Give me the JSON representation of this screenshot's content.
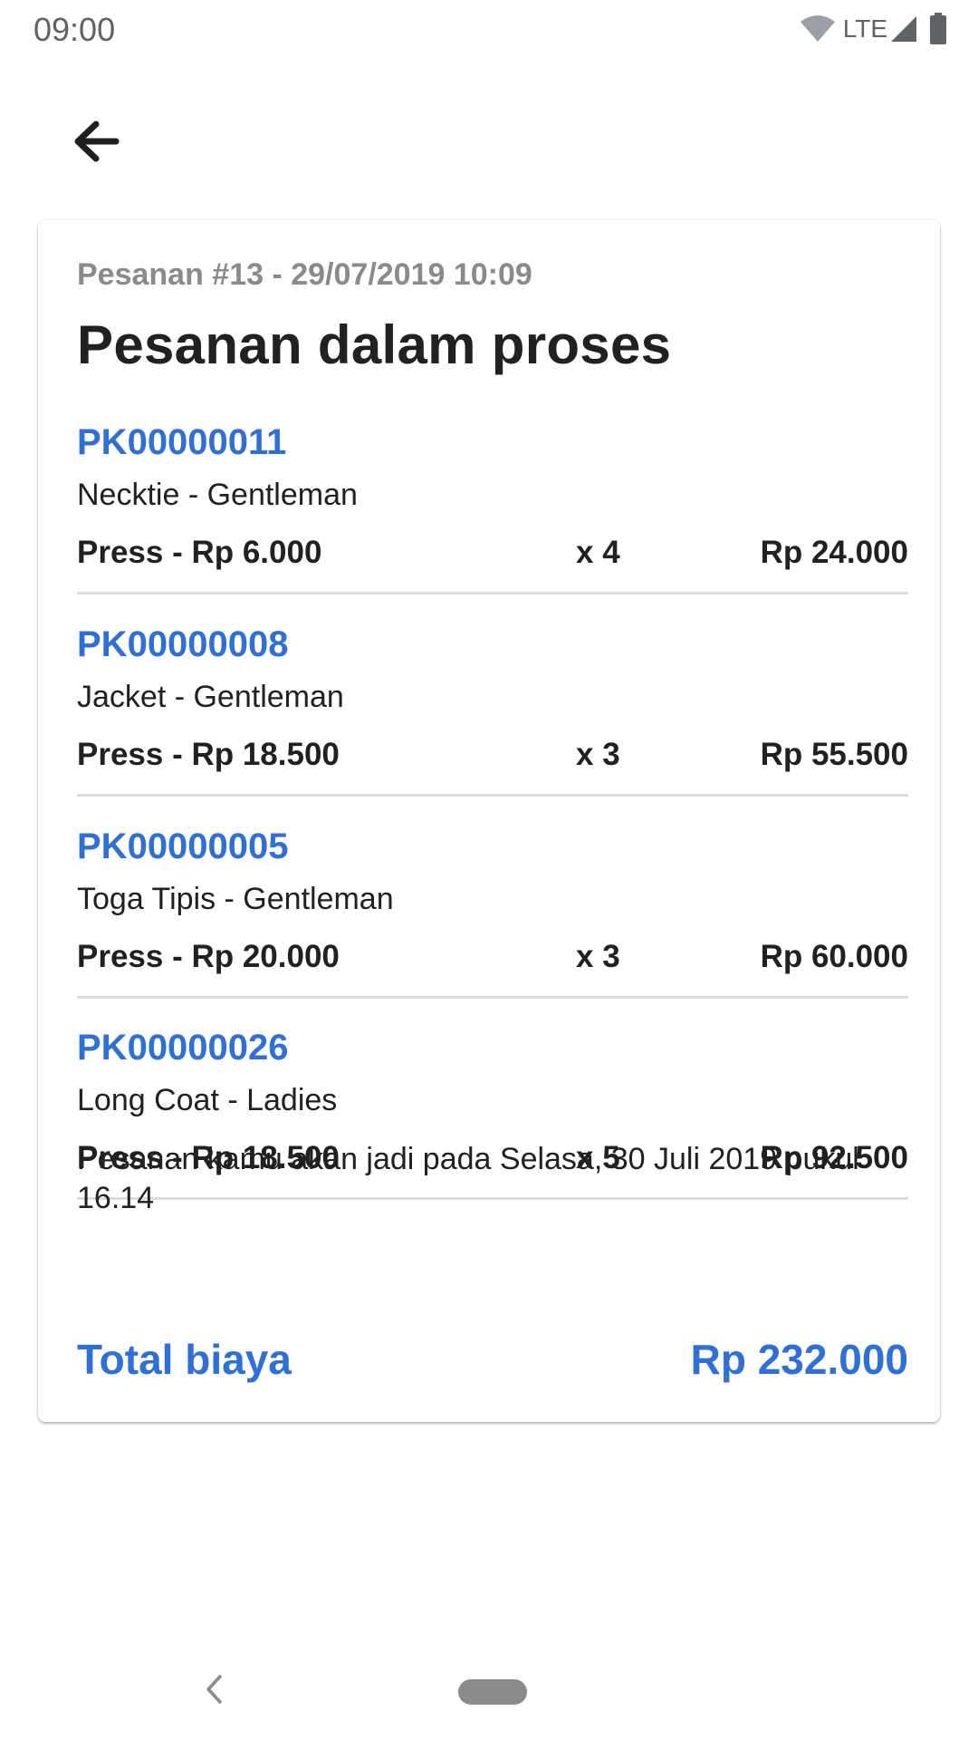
{
  "status_bar": {
    "time": "09:00",
    "network": "LTE",
    "icons": [
      "wifi-icon",
      "signal-icon",
      "battery-icon"
    ]
  },
  "app_bar": {
    "back_icon": "arrow-left-icon"
  },
  "order": {
    "meta": "Pesanan #13 - 29/07/2019 10:09",
    "status_title": "Pesanan dalam proses",
    "items": [
      {
        "code": "PK00000011",
        "name": "Necktie - Gentleman",
        "service": "Press - Rp 6.000",
        "quantity": "x 4",
        "subtotal": "Rp 24.000"
      },
      {
        "code": "PK00000008",
        "name": "Jacket - Gentleman",
        "service": "Press - Rp 18.500",
        "quantity": "x 3",
        "subtotal": "Rp 55.500"
      },
      {
        "code": "PK00000005",
        "name": "Toga Tipis - Gentleman",
        "service": "Press - Rp 20.000",
        "quantity": "x 3",
        "subtotal": "Rp 60.000"
      },
      {
        "code": "PK00000026",
        "name": "Long Coat - Ladies",
        "service": "Press - Rp 18.500",
        "quantity": "x 5",
        "subtotal": "Rp 92.500"
      }
    ],
    "completion_note": "Pesanan kamu akan jadi pada Selasa, 30 Juli 2019 pukul 16.14",
    "total_label": "Total biaya",
    "total_value": "Rp 232.000"
  },
  "colors": {
    "accent": "#2f6fd6",
    "text": "#212121",
    "muted": "#8a8a8a",
    "divider": "#dcdcdc"
  },
  "nav_bar": {
    "icons": [
      "nav-back-icon",
      "nav-home-pill"
    ]
  }
}
